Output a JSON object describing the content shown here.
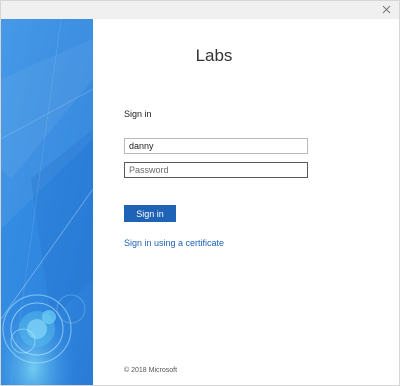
{
  "window": {
    "close_glyph": "×"
  },
  "org": {
    "name": "Labs"
  },
  "form": {
    "heading": "Sign in",
    "username_value": "danny",
    "password_placeholder": "Password",
    "submit_label": "Sign in",
    "certificate_link": "Sign in using a certificate"
  },
  "footer": {
    "copyright": "© 2018 Microsoft"
  },
  "colors": {
    "accent": "#1e63b5",
    "side_panel": "#2f8ae3"
  },
  "icons": {
    "close": "close-icon",
    "illustration": "abstract-blue-illustration"
  }
}
